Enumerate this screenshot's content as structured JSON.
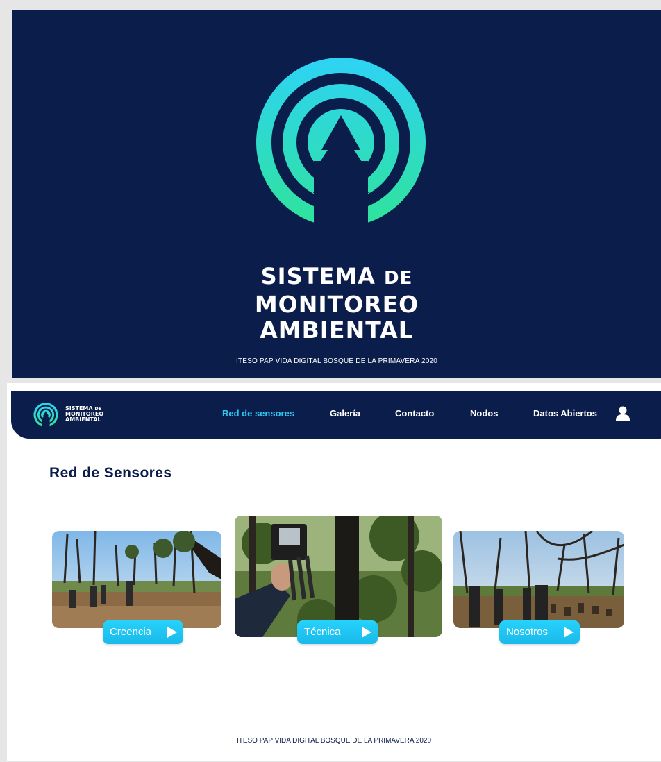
{
  "splash": {
    "title_line1": "SISTEMA",
    "title_line1_small": "DE",
    "title_line2": "MONITOREO",
    "title_line3": "AMBIENTAL",
    "footer": "ITESO PAP VIDA DIGITAL BOSQUE DE LA PRIMAVERA 2020"
  },
  "header": {
    "brand_line1": "SISTEMA",
    "brand_line1_small": "DE",
    "brand_line2": "MONITOREO",
    "brand_line3": "AMBIENTAL",
    "nav": [
      {
        "label": "Red de sensores",
        "active": true
      },
      {
        "label": "Galería",
        "active": false
      },
      {
        "label": "Contacto",
        "active": false
      },
      {
        "label": "Nodos",
        "active": false
      },
      {
        "label": "Datos Abiertos",
        "active": false
      }
    ],
    "user_icon": "user-icon"
  },
  "main": {
    "title": "Red de Sensores",
    "cards": [
      {
        "label": "Creencia",
        "icon": "play-icon",
        "photo": "field-team-photo"
      },
      {
        "label": "Técnica",
        "icon": "play-icon",
        "photo": "sensor-device-photo"
      },
      {
        "label": "Nosotros",
        "icon": "play-icon",
        "photo": "forest-walk-photo"
      }
    ]
  },
  "footer": "ITESO PAP VIDA DIGITAL BOSQUE DE LA PRIMAVERA 2020",
  "colors": {
    "navy": "#0b1d4b",
    "accent": "#2ec5f0",
    "gradient_top": "#2ed3f5",
    "gradient_bottom": "#2fe39a"
  }
}
